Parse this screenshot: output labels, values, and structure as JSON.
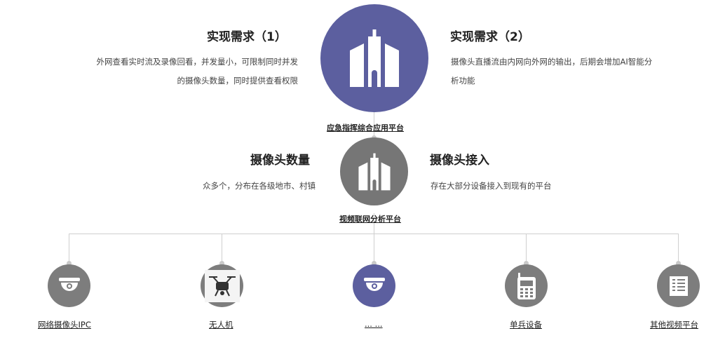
{
  "colors": {
    "primary": "#5c5f9f",
    "secondary": "#767676",
    "line": "#cfcfcf"
  },
  "top": {
    "platform_label": "应急指挥综合应用平台",
    "left": {
      "title": "实现需求（1）",
      "desc_line1": "外网查看实时流及录像回看，并发量小，可限制同时并发",
      "desc_line2": "的摄像头数量，同时提供查看权限"
    },
    "right": {
      "title": "实现需求（2）",
      "desc_line1": "摄像头直播流由内网向外网的输出，后期会增加AI智能分",
      "desc_line2": "析功能"
    }
  },
  "middle": {
    "platform_label": "视频联网分析平台",
    "left": {
      "title": "摄像头数量",
      "desc": "众多个，分布在各级地市、村镇"
    },
    "right": {
      "title": "摄像头接入",
      "desc": "存在大部分设备接入到现有的平台"
    }
  },
  "devices": [
    {
      "label": "网络摄像头IPC",
      "icon": "dome-camera-icon"
    },
    {
      "label": "无人机",
      "icon": "drone-icon"
    },
    {
      "label": "... ...",
      "icon": "dome-camera-icon"
    },
    {
      "label": "单兵设备",
      "icon": "walkie-talkie-icon"
    },
    {
      "label": "其他视频平台",
      "icon": "list-panel-icon"
    }
  ]
}
